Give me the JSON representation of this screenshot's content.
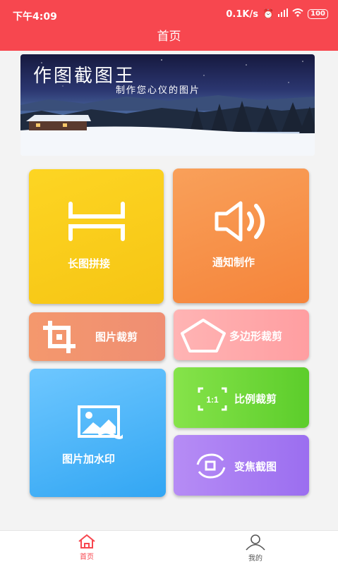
{
  "status_bar": {
    "time": "下午4:09",
    "net_speed": "0.1K/s",
    "battery": "100"
  },
  "header": {
    "title": "首页"
  },
  "banner": {
    "title": "作图截图王",
    "subtitle": "制作您心仪的图片"
  },
  "tools": {
    "long_stitch": "长图拼接",
    "notification": "通知制作",
    "image_crop": "图片裁剪",
    "polygon_crop": "多边形裁剪",
    "watermark": "图片加水印",
    "ratio_crop": "比例裁剪",
    "ratio_icon_text": "1:1",
    "zoom_crop": "变焦截图"
  },
  "tabbar": {
    "home": "首页",
    "mine": "我的"
  },
  "colors": {
    "accent": "#f7474f"
  }
}
